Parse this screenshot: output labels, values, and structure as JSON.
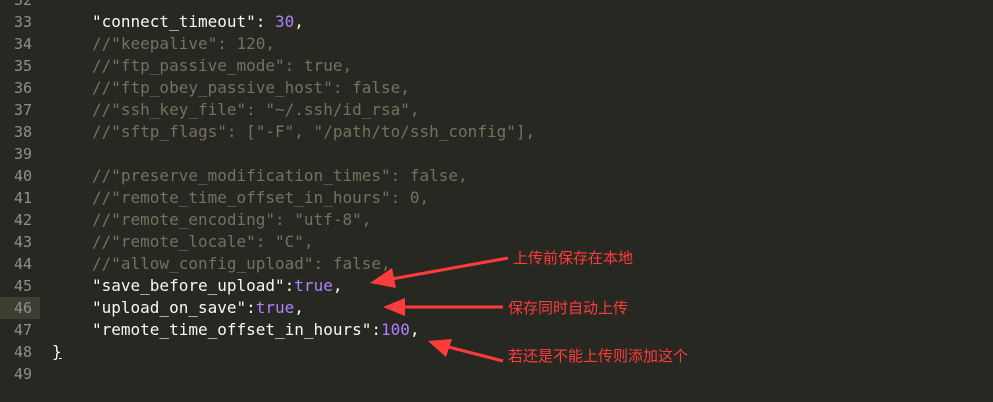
{
  "editor": {
    "lines": [
      {
        "num": "32",
        "segments": []
      },
      {
        "num": "33",
        "segments": [
          {
            "t": "\"connect_timeout\": ",
            "c": "str"
          },
          {
            "t": "30",
            "c": "num"
          },
          {
            "t": ",",
            "c": "str"
          }
        ]
      },
      {
        "num": "34",
        "segments": [
          {
            "t": "//\"keepalive\": 120,",
            "c": "cm"
          }
        ]
      },
      {
        "num": "35",
        "segments": [
          {
            "t": "//\"ftp_passive_mode\": true,",
            "c": "cm"
          }
        ]
      },
      {
        "num": "36",
        "segments": [
          {
            "t": "//\"ftp_obey_passive_host\": false,",
            "c": "cm"
          }
        ]
      },
      {
        "num": "37",
        "segments": [
          {
            "t": "//\"ssh_key_file\": \"~/.ssh/id_rsa\",",
            "c": "cm"
          }
        ]
      },
      {
        "num": "38",
        "segments": [
          {
            "t": "//\"sftp_flags\": [\"-F\", \"/path/to/ssh_config\"],",
            "c": "cm"
          }
        ]
      },
      {
        "num": "39",
        "segments": []
      },
      {
        "num": "40",
        "segments": [
          {
            "t": "//\"preserve_modification_times\": false,",
            "c": "cm"
          }
        ]
      },
      {
        "num": "41",
        "segments": [
          {
            "t": "//\"remote_time_offset_in_hours\": 0,",
            "c": "cm"
          }
        ]
      },
      {
        "num": "42",
        "segments": [
          {
            "t": "//\"remote_encoding\": \"utf-8\",",
            "c": "cm"
          }
        ]
      },
      {
        "num": "43",
        "segments": [
          {
            "t": "//\"remote_locale\": \"C\",",
            "c": "cm"
          }
        ]
      },
      {
        "num": "44",
        "segments": [
          {
            "t": "//\"allow_config_upload\": false,",
            "c": "cm"
          }
        ]
      },
      {
        "num": "45",
        "segments": [
          {
            "t": "\"save_before_upload\":",
            "c": "str"
          },
          {
            "t": "true",
            "c": "kw"
          },
          {
            "t": ",",
            "c": "str"
          }
        ]
      },
      {
        "num": "46",
        "segments": [
          {
            "t": "\"upload_on_save\":",
            "c": "str"
          },
          {
            "t": "true",
            "c": "kw"
          },
          {
            "t": ",",
            "c": "str"
          }
        ],
        "active": true
      },
      {
        "num": "47",
        "segments": [
          {
            "t": "\"remote_time_offset_in_hours\":",
            "c": "str"
          },
          {
            "t": "100",
            "c": "num"
          },
          {
            "t": ",",
            "c": "str"
          }
        ]
      },
      {
        "num": "48",
        "segments": [
          {
            "t": "}",
            "c": "brace"
          }
        ],
        "outdent": true
      },
      {
        "num": "49",
        "segments": []
      }
    ]
  },
  "annotations": {
    "save_before_upload": "上传前保存在本地",
    "upload_on_save": "保存同时自动上传",
    "remote_offset": "若还是不能上传则添加这个"
  },
  "colors": {
    "background": "#272822",
    "comment": "#75715e",
    "number": "#ae81ff",
    "annotation": "#ff3b3b"
  }
}
